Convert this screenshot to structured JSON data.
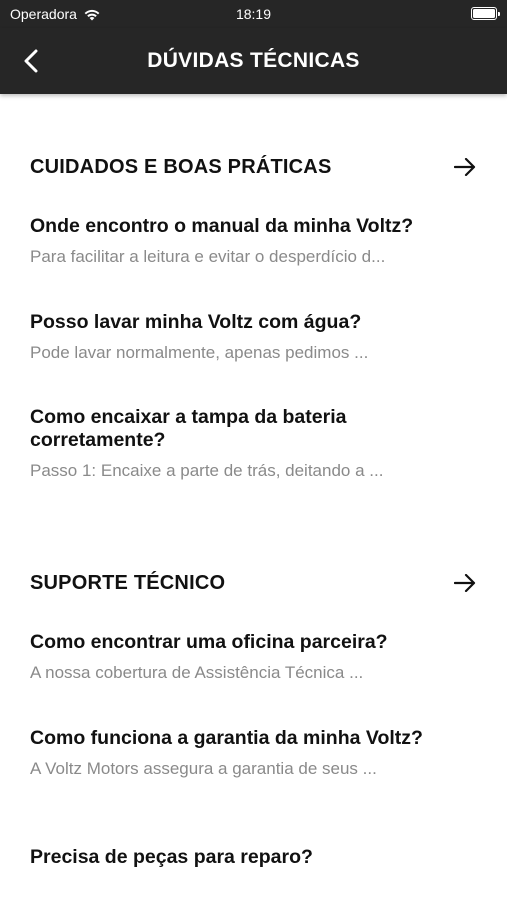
{
  "status_bar": {
    "carrier": "Operadora",
    "time": "18:19",
    "wifi_icon": "wifi-icon",
    "battery_icon": "battery-icon"
  },
  "header": {
    "title": "DÚVIDAS TÉCNICAS",
    "back_icon": "chevron-left-icon"
  },
  "sections": [
    {
      "title": "CUIDADOS E BOAS PRÁTICAS",
      "arrow_icon": "arrow-right-icon",
      "items": [
        {
          "question": "Onde encontro o manual da minha Voltz?",
          "answer": "Para facilitar a leitura e evitar o desperdício d..."
        },
        {
          "question": "Posso lavar minha Voltz com água?",
          "answer": "Pode lavar normalmente, apenas pedimos ..."
        },
        {
          "question": "Como encaixar a tampa da bateria corretamente?",
          "answer": "Passo 1: Encaixe a parte de trás, deitando a ..."
        }
      ]
    },
    {
      "title": "SUPORTE TÉCNICO",
      "arrow_icon": "arrow-right-icon",
      "items": [
        {
          "question": "Como encontrar uma oficina parceira?",
          "answer": "A nossa cobertura de Assistência Técnica ..."
        },
        {
          "question": "Como funciona a garantia da minha Voltz?",
          "answer": "A Voltz Motors assegura a garantia de seus ..."
        },
        {
          "question": "Precisa de peças para reparo?",
          "answer": ""
        }
      ]
    }
  ]
}
